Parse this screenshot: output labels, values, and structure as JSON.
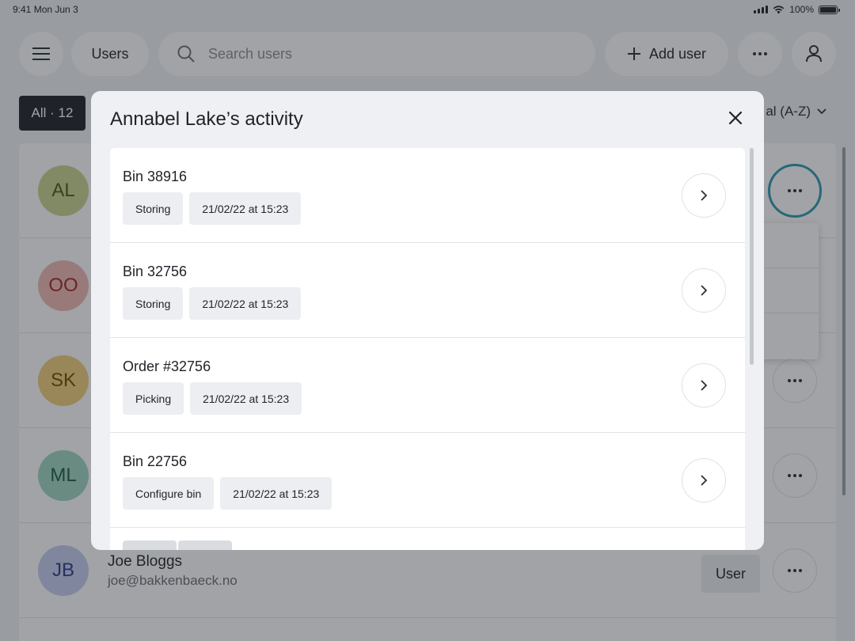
{
  "status_bar": {
    "time": "9:41",
    "date": "Mon Jun 3",
    "battery": "100%"
  },
  "header": {
    "section": "Users",
    "search_placeholder": "Search users",
    "add_user": "Add user"
  },
  "filters": {
    "all": "All · 12",
    "sort": "al (A-Z)"
  },
  "users": [
    {
      "initials": "AL",
      "name": "",
      "email": "",
      "role": ""
    },
    {
      "initials": "OO",
      "name": "",
      "email": "",
      "role": ""
    },
    {
      "initials": "SK",
      "name": "",
      "email": "",
      "role": ""
    },
    {
      "initials": "ML",
      "name": "",
      "email": "",
      "role": ""
    },
    {
      "initials": "JB",
      "name": "Joe Bloggs",
      "email": "joe@bakkenbaeck.no",
      "role": "User"
    }
  ],
  "modal": {
    "title": "Annabel Lake’s activity",
    "items": [
      {
        "title": "Bin 38916",
        "type": "Storing",
        "time": "21/02/22 at 15:23"
      },
      {
        "title": "Bin 32756",
        "type": "Storing",
        "time": "21/02/22 at 15:23"
      },
      {
        "title": "Order #32756",
        "type": "Picking",
        "time": "21/02/22 at 15:23"
      },
      {
        "title": "Bin 22756",
        "type": "Configure bin",
        "time": "21/02/22 at 15:23"
      }
    ]
  },
  "colors": {
    "accent_ring": "#2e9ab0",
    "avatar_al": "#c9d58f",
    "avatar_oo": "#f2b8b5",
    "avatar_sk": "#f1cf7b",
    "avatar_ml": "#9fd6c2",
    "avatar_jb": "#c6cdf0"
  },
  "icons": [
    "menu-icon",
    "search-icon",
    "plus-icon",
    "more-icon",
    "user-icon",
    "chevron-down-icon",
    "close-icon",
    "chevron-right-icon"
  ]
}
